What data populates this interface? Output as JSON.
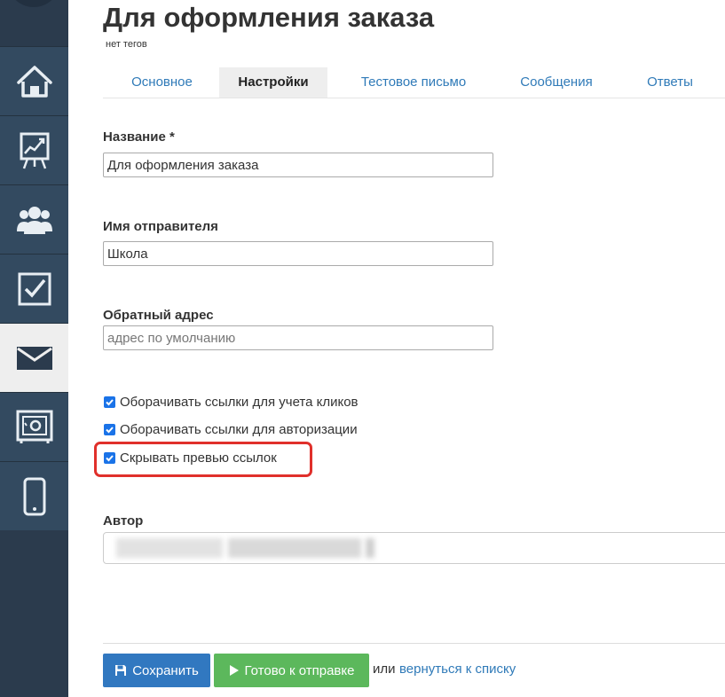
{
  "sidebar": {
    "items": [
      {
        "icon": "home-icon"
      },
      {
        "icon": "chart-board-icon"
      },
      {
        "icon": "users-icon"
      },
      {
        "icon": "checkbox-icon"
      },
      {
        "icon": "mail-icon",
        "active": true
      },
      {
        "icon": "safe-icon"
      },
      {
        "icon": "phone-icon"
      }
    ]
  },
  "header": {
    "title": "Для оформления заказа",
    "tags": "нет тегов"
  },
  "tabs": [
    {
      "label": "Основное"
    },
    {
      "label": "Настройки",
      "active": true
    },
    {
      "label": "Тестовое письмо"
    },
    {
      "label": "Сообщения"
    },
    {
      "label": "Ответы"
    }
  ],
  "form": {
    "name_label": "Название *",
    "name_value": "Для оформления заказа",
    "sender_label": "Имя отправителя",
    "sender_value": "Школа",
    "reply_label": "Обратный адрес",
    "reply_value": "",
    "reply_placeholder": "адрес по умолчанию",
    "checkboxes": [
      {
        "label": "Оборачивать ссылки для учета кликов",
        "checked": true
      },
      {
        "label": "Оборачивать ссылки для авторизации",
        "checked": true
      },
      {
        "label": "Скрывать превью ссылок",
        "checked": true
      }
    ],
    "author_label": "Автор"
  },
  "actions": {
    "save_label": "Сохранить",
    "ready_label": "Готово к отправке",
    "or_text": "или",
    "back_link": "вернуться к списку"
  },
  "colors": {
    "sidebar_bg": "#2b3b4d",
    "sidebar_item_bg": "#334a60",
    "link": "#2f7ab8",
    "save_button": "#3178c0",
    "ready_button": "#5cb85c",
    "highlight": "#e0302b",
    "checkbox": "#1a73e8"
  }
}
